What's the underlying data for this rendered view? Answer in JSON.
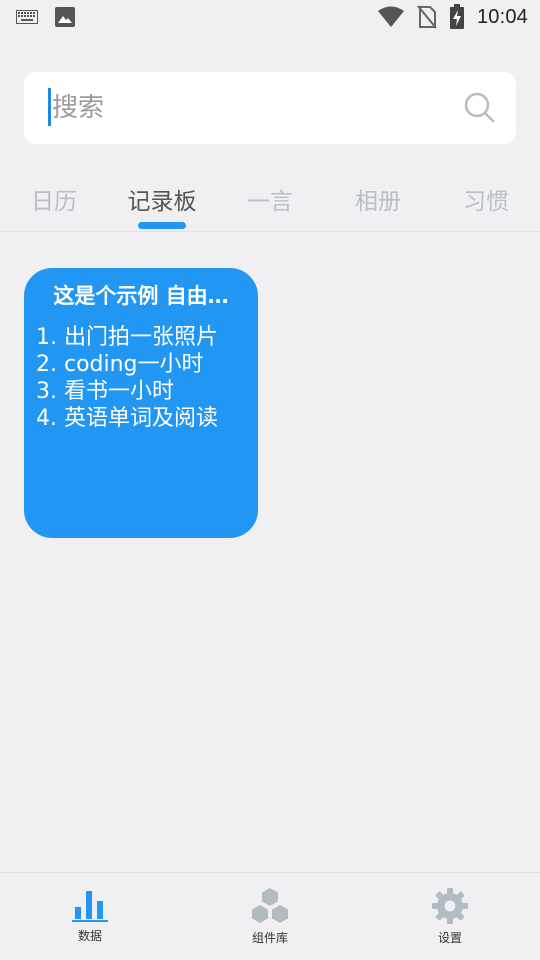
{
  "status_bar": {
    "time": "10:04",
    "icons": [
      "keyboard-icon",
      "image-icon",
      "wifi-icon",
      "no-sim-icon",
      "battery-charging-icon"
    ]
  },
  "search": {
    "placeholder": "搜索"
  },
  "tabs": [
    {
      "label": "日历",
      "active": false
    },
    {
      "label": "记录板",
      "active": true
    },
    {
      "label": "一言",
      "active": false
    },
    {
      "label": "相册",
      "active": false
    },
    {
      "label": "习惯",
      "active": false
    }
  ],
  "note": {
    "title": "这是个示例 自由…",
    "lines": [
      "1. 出门拍一张照片",
      "2. coding一小时",
      "3. 看书一小时",
      "4. 英语单词及阅读"
    ],
    "color": "#2196f3"
  },
  "bottom_nav": [
    {
      "label": "数据",
      "icon": "bar-chart-icon"
    },
    {
      "label": "组件库",
      "icon": "hexagons-icon"
    },
    {
      "label": "设置",
      "icon": "gear-icon"
    }
  ],
  "colors": {
    "accent": "#2196f3",
    "background": "#f0f0f3",
    "inactive_tab": "#b9bfc7"
  }
}
